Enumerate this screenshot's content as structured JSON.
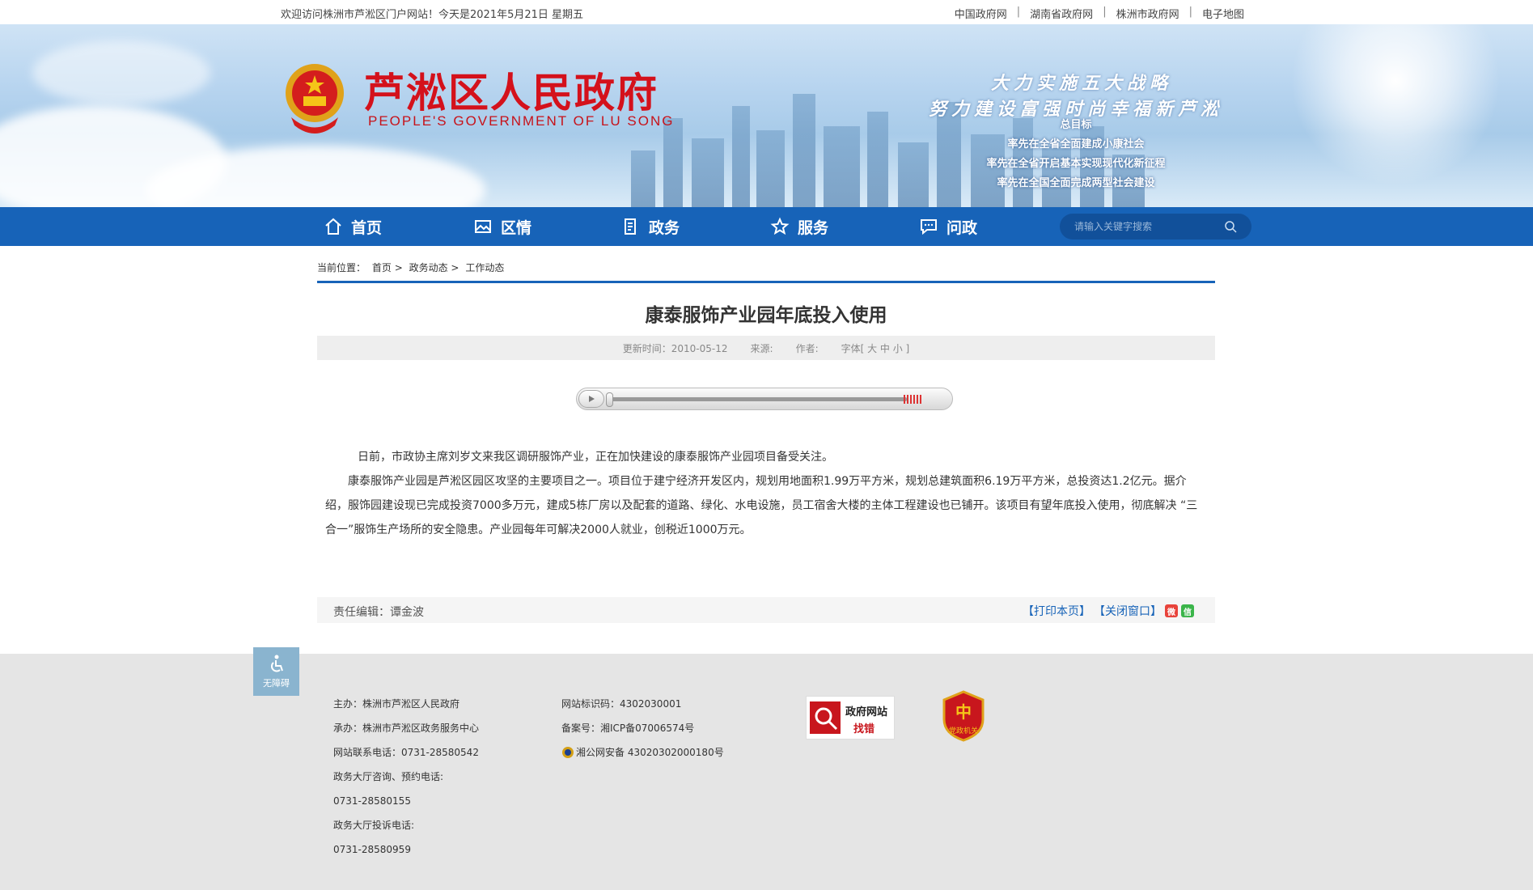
{
  "topbar": {
    "welcome": "欢迎访问株洲市芦淞区门户网站！今天是2021年5月21日 星期五",
    "links": [
      "中国政府网",
      "湖南省政府网",
      "株洲市政府网",
      "电子地图"
    ]
  },
  "header": {
    "title": "芦淞区人民政府",
    "subtitle": "PEOPLE'S GOVERNMENT OF  LU SONG",
    "slogan_line1": "大力实施五大战略",
    "slogan_line2": "努力建设富强时尚幸福新芦淞",
    "goals": [
      "总目标",
      "率先在全省全面建成小康社会",
      "率先在全省开启基本实现现代化新征程",
      "率先在全国全面完成两型社会建设"
    ]
  },
  "nav": {
    "items": [
      {
        "label": "首页",
        "icon": "home-icon"
      },
      {
        "label": "区情",
        "icon": "picture-icon"
      },
      {
        "label": "政务",
        "icon": "document-icon"
      },
      {
        "label": "服务",
        "icon": "star-icon"
      },
      {
        "label": "问政",
        "icon": "chat-icon"
      }
    ],
    "search_placeholder": "请输入关键字搜索"
  },
  "breadcrumb": {
    "prefix": "当前位置：",
    "items": [
      "首页",
      "政务动态",
      "工作动态"
    ],
    "separator": ">"
  },
  "article": {
    "title": "康泰服饰产业园年底投入使用",
    "updated": "更新时间：2010-05-12",
    "source": "来源:",
    "author": "作者:",
    "font_size": "字体[ 大 中 小 ]",
    "paragraphs": [
      "日前，市政协主席刘岁文来我区调研服饰产业，正在加快建设的康泰服饰产业园项目备受关注。",
      "康泰服饰产业园是芦淞区园区攻坚的主要项目之一。项目位于建宁经济开发区内，规划用地面积1.99万平方米，规划总建筑面积6.19万平方米，总投资达1.2亿元。据介绍，服饰园建设现已完成投资7000多万元，建成5栋厂房以及配套的道路、绿化、水电设施，员工宿舍大楼的主体工程建设也已铺开。该项目有望年底投入使用，彻底解决 “三合一”服饰生产场所的安全隐患。产业园每年可解决2000人就业，创税近1000万元。"
    ],
    "editor": "责任编辑：谭金波",
    "print": "【打印本页】",
    "close": "【关闭窗口】"
  },
  "footer": {
    "accessibility": "无障碍",
    "col1": [
      "主办：株洲市芦淞区人民政府",
      "承办：株洲市芦淞区政务服务中心",
      "网站联系电话：0731-28580542",
      "政务大厅咨询、预约电话:",
      "0731-28580155",
      "政务大厅投诉电话:",
      "0731-28580959"
    ],
    "col2": [
      "网站标识码：4302030001",
      " 备案号：湘ICP备07006574号",
      "湘公网安备 43020302000180号"
    ],
    "badge1_top": "政府网站",
    "badge1_bottom": "找错",
    "badge2_text": "党政机关"
  },
  "colors": {
    "brand_blue": "#1763b8",
    "title_red": "#d4111b",
    "footer_bg": "#e5e5e5"
  }
}
